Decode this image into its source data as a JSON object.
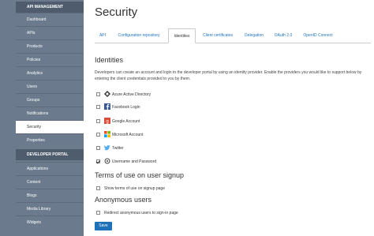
{
  "sidebar": {
    "api_header": "API MANAGEMENT",
    "api_items": [
      "Dashboard",
      "APIs",
      "Products",
      "Policies",
      "Analytics",
      "Users",
      "Groups",
      "Notifications",
      "Security",
      "Properties"
    ],
    "portal_header": "DEVELOPER PORTAL",
    "portal_items": [
      "Applications",
      "Content",
      "Blogs",
      "Media Library",
      "Widgets"
    ],
    "active_item": "Security"
  },
  "page": {
    "title": "Security"
  },
  "tabs": [
    "API",
    "Configuration repository",
    "Identities",
    "Client certificates",
    "Delegation",
    "OAuth 2.0",
    "OpenID Connect"
  ],
  "active_tab": "Identities",
  "identities": {
    "heading": "Identities",
    "description": "Developers can create an account and login to the developer portal by using an identity provider. Enable the providers you would like to support below by entering the client credentials provided to you by them.",
    "providers": [
      {
        "label": "Azure Active Directory",
        "checked": false,
        "icon": "azure-icon"
      },
      {
        "label": "Facebook Login",
        "checked": false,
        "icon": "facebook-icon"
      },
      {
        "label": "Google Account",
        "checked": false,
        "icon": "google-icon"
      },
      {
        "label": "Microsoft Account",
        "checked": false,
        "icon": "microsoft-icon"
      },
      {
        "label": "Twitter",
        "checked": false,
        "icon": "twitter-icon"
      },
      {
        "label": "Username and Password",
        "checked": true,
        "icon": "user-password-icon"
      }
    ]
  },
  "terms": {
    "heading": "Terms of use on user signup",
    "option": "Show terms of use on signup page",
    "checked": false
  },
  "anonymous": {
    "heading": "Anonymous users",
    "option": "Redirect anonymous users to sign-in page",
    "checked": false
  },
  "save_label": "Save",
  "colors": {
    "sidebar_bg": "#6b7a8d",
    "sidebar_header_bg": "#4f5c6d",
    "accent": "#1f72b8",
    "facebook": "#3b5998",
    "google": "#dd4b39",
    "twitter": "#55acee"
  }
}
